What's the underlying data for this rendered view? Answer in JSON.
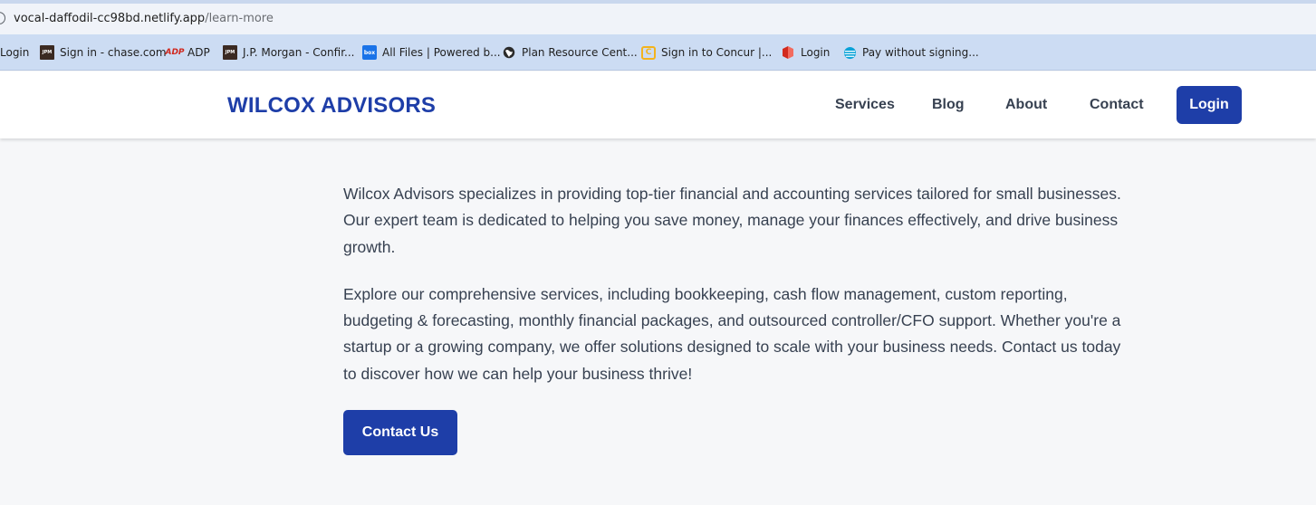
{
  "browser": {
    "url_host": "vocal-daffodil-cc98bd.netlify.app",
    "url_path": "/learn-more"
  },
  "bookmarks": [
    {
      "label": "Login",
      "icon": "none"
    },
    {
      "label": "Sign in - chase.com",
      "icon": "jpm-icon"
    },
    {
      "label": "ADP",
      "icon": "adp-icon"
    },
    {
      "label": "J.P. Morgan - Confir...",
      "icon": "jpm-icon"
    },
    {
      "label": "All Files | Powered b...",
      "icon": "box-icon"
    },
    {
      "label": "Plan Resource Cent...",
      "icon": "globe-icon"
    },
    {
      "label": "Sign in to Concur |...",
      "icon": "concur-icon"
    },
    {
      "label": "Login",
      "icon": "lincoln-icon"
    },
    {
      "label": "Pay without signing...",
      "icon": "att-icon"
    }
  ],
  "header": {
    "brand": "WILCOX ADVISORS",
    "nav": [
      "Services",
      "Blog",
      "About",
      "Contact"
    ],
    "login_label": "Login"
  },
  "main": {
    "paragraphs": [
      "Wilcox Advisors specializes in providing top-tier financial and accounting services tailored for small businesses. Our expert team is dedicated to helping you save money, manage your finances effectively, and drive business growth.",
      "Explore our comprehensive services, including bookkeeping, cash flow management, custom reporting, budgeting & forecasting, monthly financial packages, and outsourced controller/CFO support. Whether you're a startup or a growing company, we offer solutions designed to scale with your business needs. Contact us today to discover how we can help your business thrive!"
    ],
    "cta_label": "Contact Us"
  },
  "colors": {
    "brand": "#1e3ea8",
    "page_bg": "#f6f7f9",
    "text": "#374151",
    "bookmark_bar": "#ccdcf3"
  }
}
